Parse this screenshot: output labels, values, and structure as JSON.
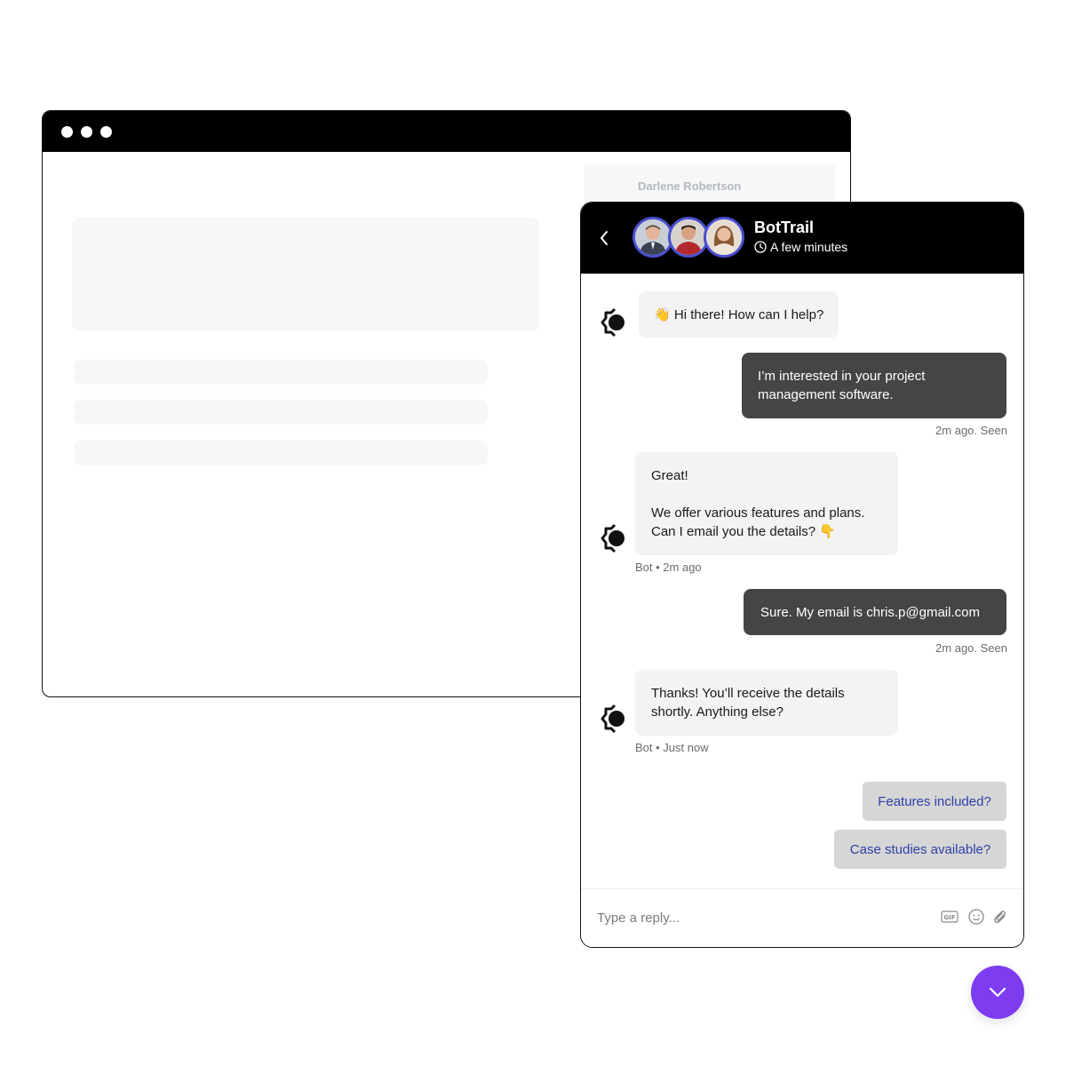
{
  "background_window": {
    "contact_name": "Darlene Robertson"
  },
  "chat": {
    "title": "BotTrail",
    "response_time": "A few minutes",
    "messages": [
      {
        "sender": "bot",
        "emoji": "👋",
        "text": "Hi there! How can I help?"
      },
      {
        "sender": "user",
        "text": "I’m interested in your project management software.",
        "status": "2m ago. Seen"
      },
      {
        "sender": "bot",
        "line1": "Great!",
        "line2": "We offer various features and plans.",
        "line3": "Can I email you the details?",
        "emoji": "👇",
        "meta": "Bot • 2m ago"
      },
      {
        "sender": "user",
        "text": "Sure. My email is chris.p@gmail.com",
        "status": "2m ago. Seen"
      },
      {
        "sender": "bot",
        "text": "Thanks! You’ll receive the details shortly. Anything else?",
        "meta": "Bot • Just now"
      }
    ],
    "quick_replies": [
      "Features included?",
      "Case studies available?"
    ],
    "reply_placeholder": "Type a reply...",
    "footer_icons": [
      "gif-icon",
      "emoji-icon",
      "paperclip-icon"
    ]
  },
  "colors": {
    "header": "#000000",
    "user_bubble": "#454545",
    "bot_bubble": "#f3f3f3",
    "quick_reply_bg": "#d6d6d6",
    "quick_reply_text": "#2d3fa8",
    "avatar_ring": "#4a4fd1",
    "launcher": "#7d3cf0"
  }
}
